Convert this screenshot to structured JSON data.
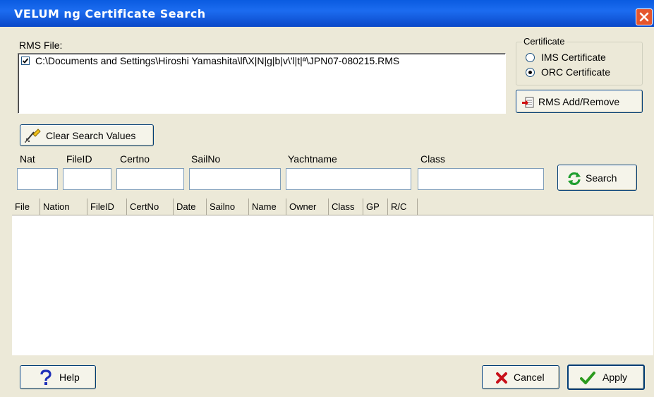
{
  "window": {
    "title": "VELUM ng Certificate Search"
  },
  "rms": {
    "label": "RMS File:",
    "files": [
      {
        "checked": true,
        "path": "C:\\Documents and Settings\\Hiroshi Yamashita\\lf\\X|N|g|b|v\\'l|t|ª\\JPN07-080215.RMS"
      }
    ],
    "add_remove_label": "RMS Add/Remove"
  },
  "certificate": {
    "legend": "Certificate",
    "options": [
      {
        "label": "IMS Certificate",
        "selected": false
      },
      {
        "label": "ORC Certificate",
        "selected": true
      }
    ]
  },
  "search": {
    "clear_label": "Clear Search Values",
    "fields": [
      {
        "label": "Nat",
        "value": ""
      },
      {
        "label": "FileID",
        "value": ""
      },
      {
        "label": "Certno",
        "value": ""
      },
      {
        "label": "SailNo",
        "value": ""
      },
      {
        "label": "Yachtname",
        "value": ""
      },
      {
        "label": "Class",
        "value": ""
      }
    ],
    "search_label": "Search"
  },
  "results": {
    "columns": [
      "File",
      "Nation",
      "FileID",
      "CertNo",
      "Date",
      "Sailno",
      "Name",
      "Owner",
      "Class",
      "GP",
      "R/C"
    ],
    "rows": []
  },
  "footer": {
    "help_label": "Help",
    "cancel_label": "Cancel",
    "apply_label": "Apply"
  },
  "colors": {
    "title_bar": "#0A5BE0",
    "close": "#E5552C",
    "window_bg": "#ECE9D8"
  }
}
